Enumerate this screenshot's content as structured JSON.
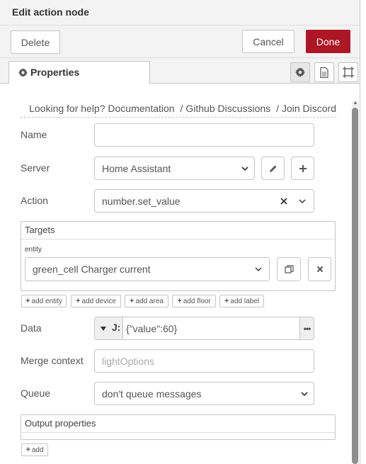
{
  "title": "Edit action node",
  "toolbar": {
    "delete_label": "Delete",
    "cancel_label": "Cancel",
    "done_label": "Done"
  },
  "tabs": {
    "properties_label": "Properties"
  },
  "help": {
    "prefix": "Looking for help?",
    "documentation": "Documentation",
    "separator": "/",
    "github": "Github Discussions",
    "discord": "Join Discord"
  },
  "form": {
    "name_label": "Name",
    "name_value": "",
    "server_label": "Server",
    "server_value": "Home Assistant",
    "action_label": "Action",
    "action_value": "number.set_value",
    "targets_title": "Targets",
    "entity_label": "entity",
    "entity_value": "green_cell Charger current",
    "add_buttons": [
      "add entity",
      "add device",
      "add area",
      "add floor",
      "add label"
    ],
    "data_label": "Data",
    "data_value": "{\"value\":60}",
    "data_type_glyph": "J:",
    "merge_label": "Merge context",
    "merge_placeholder": "lightOptions",
    "queue_label": "Queue",
    "queue_value": "don't queue messages",
    "output_title": "Output properties",
    "add_label": "add"
  },
  "colors": {
    "accent": "#ad1625",
    "border": "#c5c5c5",
    "toolbar_bg": "#f3f3f3"
  },
  "icons": [
    "gear-icon",
    "document-icon",
    "frame-icon",
    "pencil-icon",
    "plus-icon",
    "clear-icon",
    "chevron-down-icon",
    "copy-icon",
    "close-icon",
    "ellipsis-icon"
  ]
}
